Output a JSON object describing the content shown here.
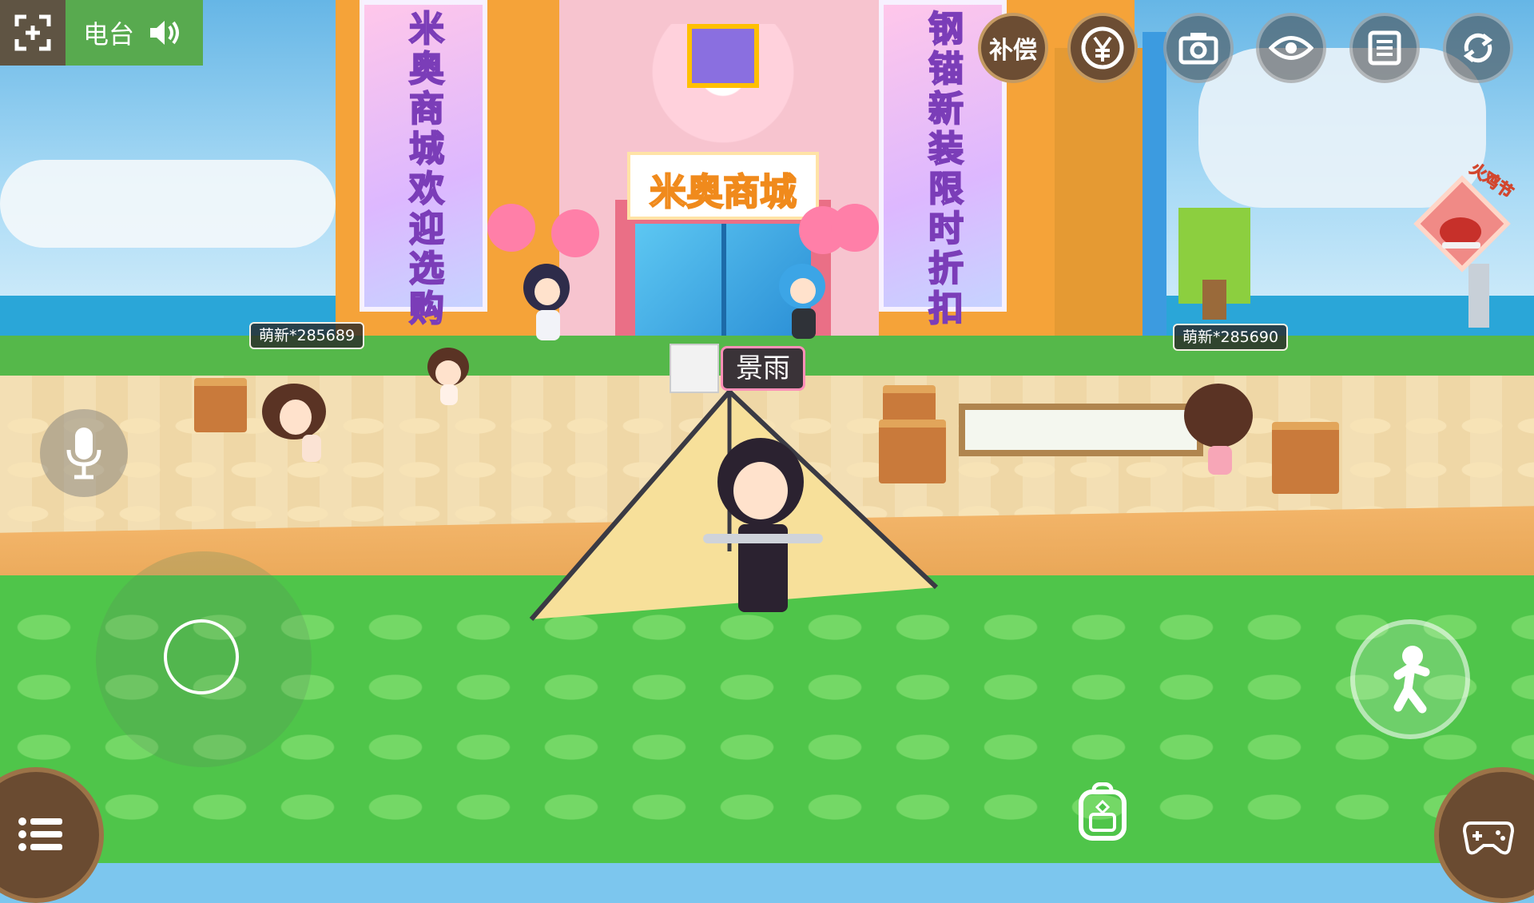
{
  "hud": {
    "radio_label": "电台",
    "top_buttons": [
      {
        "label": "补偿",
        "icon": "compensation-icon"
      },
      {
        "label": "",
        "icon": "yen-icon"
      },
      {
        "label": "",
        "icon": "camera-icon"
      },
      {
        "label": "",
        "icon": "eye-icon"
      },
      {
        "label": "",
        "icon": "list-icon"
      },
      {
        "label": "",
        "icon": "refresh-icon"
      }
    ],
    "event_badge_label": "火鸡节"
  },
  "scene": {
    "building_sign": "米奥商城",
    "banner_left": "米奥商城 欢迎选购",
    "banner_right": "钢锚新装 限时折扣"
  },
  "players": {
    "main_name": "景雨",
    "left_tag": "萌新*285689",
    "right_tag": "萌新*285690"
  },
  "colors": {
    "grass": "#4fc54a",
    "building": "#f5a339",
    "radio_green": "#58aa4f",
    "hud_brown": "#6c4d33"
  }
}
